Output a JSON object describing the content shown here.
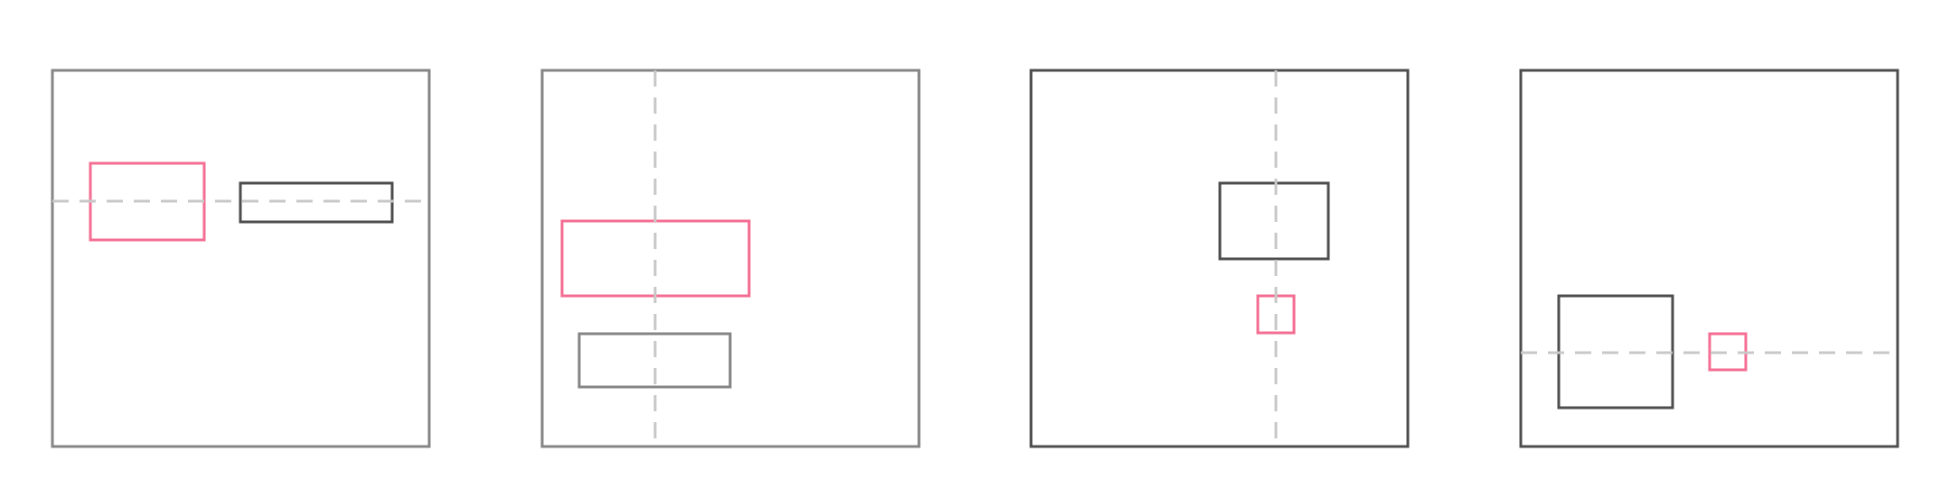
{
  "colors": {
    "background": "#ffffff",
    "highlight": "#f46d92",
    "panel_light": "#858585",
    "panel_dark": "#4d4d4d",
    "guide": "#c8c8c8"
  },
  "panels": [
    {
      "frame_tone": "light",
      "guide": "horizontal",
      "boxes": [
        {
          "role": "highlight",
          "tone": "pink"
        },
        {
          "role": "other",
          "tone": "dark"
        }
      ]
    },
    {
      "frame_tone": "light",
      "guide": "vertical",
      "boxes": [
        {
          "role": "highlight",
          "tone": "pink"
        },
        {
          "role": "other",
          "tone": "light"
        }
      ]
    },
    {
      "frame_tone": "dark",
      "guide": "vertical",
      "boxes": [
        {
          "role": "other",
          "tone": "dark"
        },
        {
          "role": "highlight",
          "tone": "pink"
        }
      ]
    },
    {
      "frame_tone": "dark",
      "guide": "horizontal",
      "boxes": [
        {
          "role": "other",
          "tone": "dark"
        },
        {
          "role": "highlight",
          "tone": "pink"
        }
      ]
    }
  ]
}
